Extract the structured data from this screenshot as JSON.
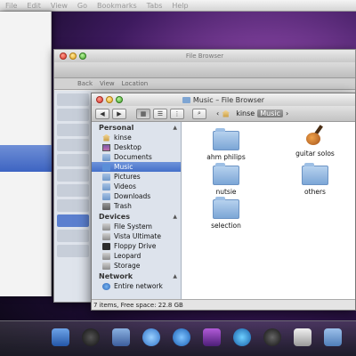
{
  "menubar": {
    "items": [
      "File",
      "Edit",
      "View",
      "Go",
      "Bookmarks",
      "Tabs",
      "Help"
    ]
  },
  "back_window": {
    "title": "File Browser",
    "toolbar_items": [
      "Back",
      "View",
      "Location"
    ]
  },
  "window": {
    "title": "Music – File Browser"
  },
  "breadcrumb": {
    "home": "kinse",
    "current": "Music"
  },
  "sidebar": {
    "personal": "Personal",
    "personal_items": [
      "kinse",
      "Desktop",
      "Documents",
      "Music",
      "Pictures",
      "Videos",
      "Downloads",
      "Trash"
    ],
    "devices": "Devices",
    "device_items": [
      "File System",
      "Vista Ultimate",
      "Floppy Drive",
      "Leopard",
      "Storage"
    ],
    "network": "Network",
    "network_items": [
      "Entire network"
    ]
  },
  "files": [
    "ahm philips",
    "guitar solos",
    "nutsie",
    "others",
    "selection"
  ],
  "status": "7 items, Free space: 22.8 GB",
  "colors": {
    "selection": "#4470c9",
    "sidebar_bg": "#dde3ec",
    "folder": "#7ca6d6"
  }
}
